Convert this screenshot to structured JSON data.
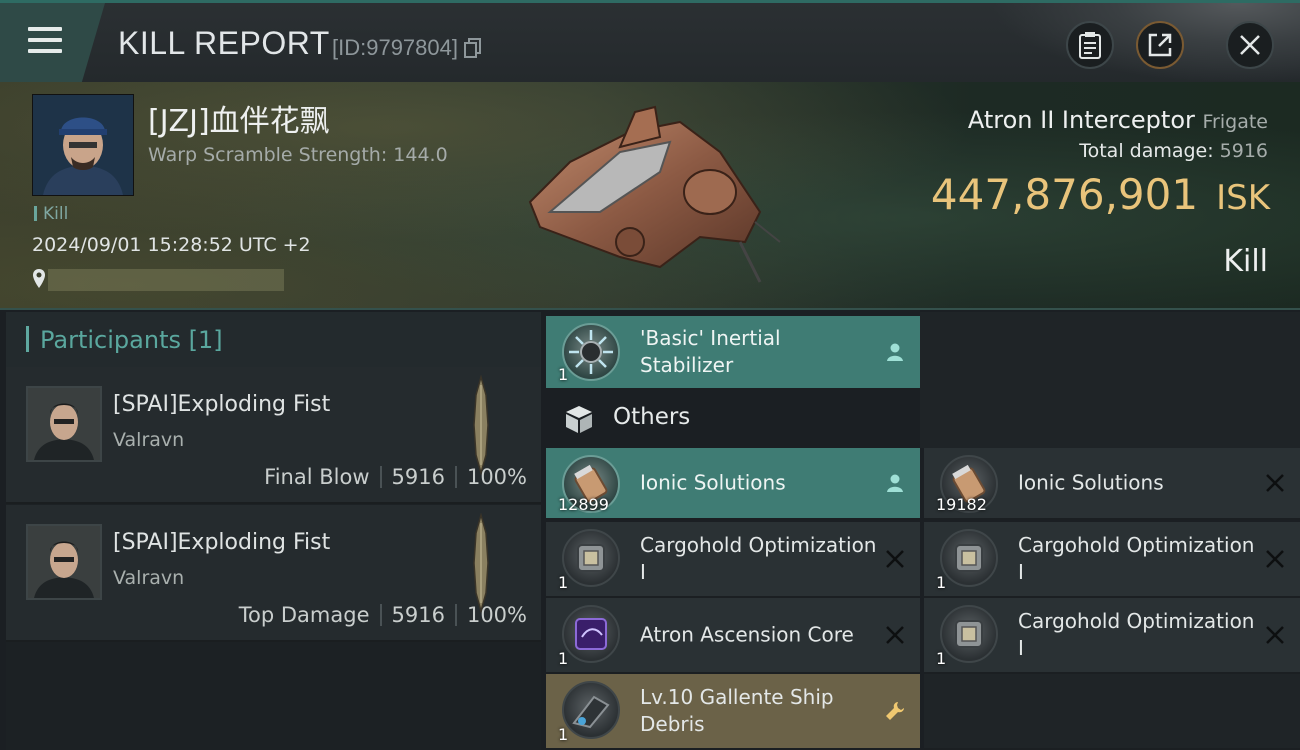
{
  "header": {
    "title": "KILL REPORT",
    "report_id": "[ID:9797804]"
  },
  "victim": {
    "pilot_name": "[JZJ]血伴花飘",
    "warp_scramble": "Warp Scramble Strength: 144.0",
    "kill_tag": "Kill",
    "datetime": "2024/09/01 15:28:52 UTC +2"
  },
  "ship": {
    "name": "Atron II Interceptor",
    "class": "Frigate",
    "total_damage_label": "Total damage:",
    "total_damage_value": "5916",
    "isk_value": "447,876,901",
    "isk_unit": "ISK",
    "result": "Kill"
  },
  "participants": {
    "title": "Participants",
    "count": "[1]",
    "rows": [
      {
        "name": "[SPAI]Exploding Fist",
        "ship": "Valravn",
        "role": "Final Blow",
        "damage": "5916",
        "percent": "100%"
      },
      {
        "name": "[SPAI]Exploding Fist",
        "ship": "Valravn",
        "role": "Top Damage",
        "damage": "5916",
        "percent": "100%"
      }
    ]
  },
  "items": {
    "top_item": {
      "name": "'Basic' Inertial Stabilizer",
      "qty": "1",
      "status": "dropped"
    },
    "others_label": "Others",
    "left": [
      {
        "name": "Ionic Solutions",
        "qty": "12899",
        "status": "dropped"
      },
      {
        "name": "Cargohold Optimization I",
        "qty": "1",
        "status": "destroyed"
      },
      {
        "name": "Atron Ascension Core",
        "qty": "1",
        "status": "destroyed"
      },
      {
        "name": "Lv.10 Gallente Ship Debris",
        "qty": "1",
        "status": "special"
      }
    ],
    "right": [
      {
        "name": "Ionic Solutions",
        "qty": "19182",
        "status": "destroyed"
      },
      {
        "name": "Cargohold Optimization I",
        "qty": "1",
        "status": "destroyed"
      },
      {
        "name": "Cargohold Optimization I",
        "qty": "1",
        "status": "destroyed"
      }
    ]
  },
  "colors": {
    "accent_teal": "#3f7c74",
    "isk_gold": "#e9c47b",
    "special_tan": "#6b6248"
  },
  "icons": [
    "menu-icon",
    "copy-icon",
    "clipboard-icon",
    "share-icon",
    "close-icon",
    "location-pin-icon",
    "person-icon",
    "x-icon",
    "wrench-icon",
    "cube-icon"
  ]
}
